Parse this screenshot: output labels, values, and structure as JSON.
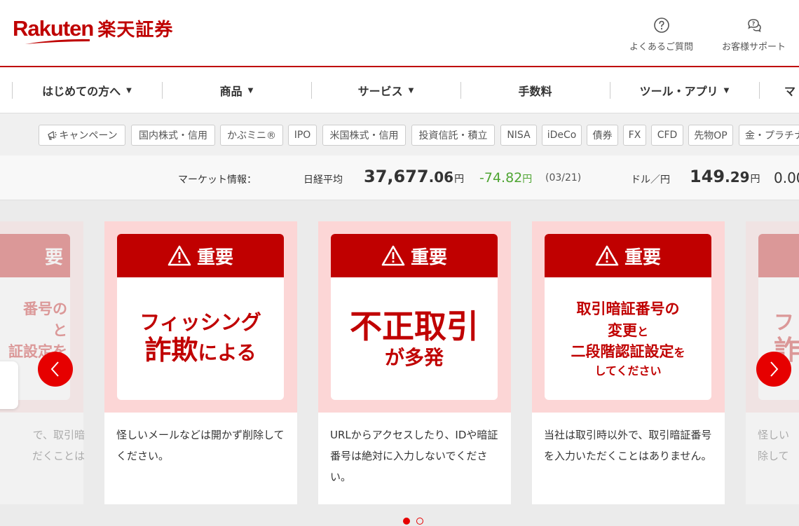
{
  "header": {
    "logo_en": "Rakuten",
    "logo_ja": "楽天証券",
    "faq_label": "よくあるご質問",
    "support_label": "お客様サポート"
  },
  "main_nav": [
    {
      "label": "はじめての方へ",
      "caret": "▼"
    },
    {
      "label": "商品",
      "caret": "▼"
    },
    {
      "label": "サービス",
      "caret": "▼"
    },
    {
      "label": "手数料",
      "caret": ""
    },
    {
      "label": "ツール・アプリ",
      "caret": "▼"
    },
    {
      "label": "マ",
      "caret": ""
    }
  ],
  "sub_nav": [
    "キャンペーン",
    "国内株式・信用",
    "かぶミニ®",
    "IPO",
    "米国株式・信用",
    "投資信託・積立",
    "NISA",
    "iDeCo",
    "債券",
    "FX",
    "CFD",
    "先物OP",
    "金・プラチナ"
  ],
  "market": {
    "label": "マーケット情報：",
    "nikkei_label": "日経平均",
    "nikkei_int": "37,677",
    "nikkei_dec": ".06",
    "unit": "円",
    "nikkei_change": "-74.82",
    "date": "(03/21)",
    "usd_label": "ドル／円",
    "usd_int": "149",
    "usd_dec": ".29",
    "usd_change": "0.00"
  },
  "carousel": {
    "heading": "重要",
    "cards": [
      {
        "line1": "フィッシング",
        "line2a": "詐欺",
        "line2b": "による",
        "text": "怪しいメールなどは開かず削除してください。"
      },
      {
        "line1": "不正取引",
        "line2": "が多発",
        "text": "URLからアクセスしたり、IDや暗証番号は絶対に入力しないでください。"
      },
      {
        "line1": "取引暗証番号の",
        "line2a": "変更",
        "line2b": "と",
        "line3": "二段階認証設定",
        "line3b": "を",
        "line4": "してください",
        "text": "当社は取引時以外で、取引暗証番号を入力いただくことはありません。"
      }
    ],
    "left_partial": {
      "head": "要",
      "l1": "番号の",
      "l2": "と",
      "l3": "証設定を",
      "l4": "い",
      "t1": "で、取引暗",
      "t2": "だくことは"
    },
    "right_partial": {
      "l1": "フ",
      "l2": "詐",
      "t1": "怪しい",
      "t2": "除して"
    },
    "prev_label": "‹",
    "next_label": "›"
  },
  "colors": {
    "brand": "#bf0000",
    "accent": "#e60000",
    "positive": "#4fa533"
  }
}
